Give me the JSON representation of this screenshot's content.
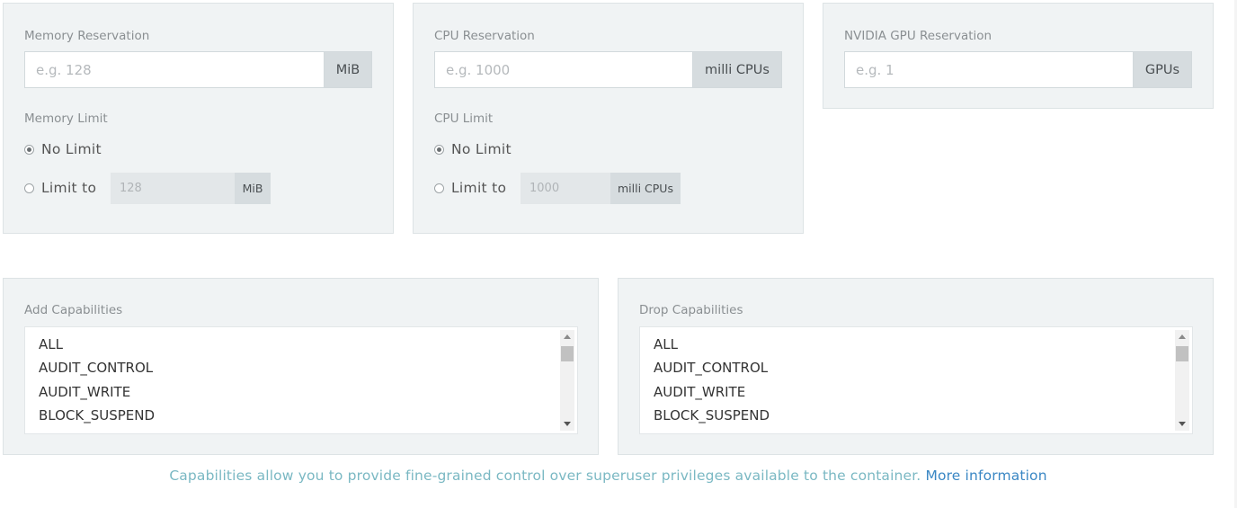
{
  "memory": {
    "reservation_label": "Memory Reservation",
    "reservation_placeholder": "e.g. 128",
    "reservation_unit": "MiB",
    "limit_label": "Memory Limit",
    "no_limit_label": "No Limit",
    "limit_to_label": "Limit to",
    "limit_to_placeholder": "128",
    "limit_to_unit": "MiB",
    "selected": "No Limit"
  },
  "cpu": {
    "reservation_label": "CPU Reservation",
    "reservation_placeholder": "e.g. 1000",
    "reservation_unit": "milli CPUs",
    "limit_label": "CPU Limit",
    "no_limit_label": "No Limit",
    "limit_to_label": "Limit to",
    "limit_to_placeholder": "1000",
    "limit_to_unit": "milli CPUs",
    "selected": "No Limit"
  },
  "gpu": {
    "reservation_label": "NVIDIA GPU Reservation",
    "reservation_placeholder": "e.g. 1",
    "reservation_unit": "GPUs"
  },
  "add_capabilities": {
    "label": "Add Capabilities",
    "items": [
      "ALL",
      "AUDIT_CONTROL",
      "AUDIT_WRITE",
      "BLOCK_SUSPEND"
    ]
  },
  "drop_capabilities": {
    "label": "Drop Capabilities",
    "items": [
      "ALL",
      "AUDIT_CONTROL",
      "AUDIT_WRITE",
      "BLOCK_SUSPEND"
    ]
  },
  "help": {
    "text": "Capabilities allow you to provide fine-grained control over superuser privileges available to the container.",
    "link_text": "More information"
  },
  "colors": {
    "panel_bg": "#f0f3f4",
    "addon_bg": "#d6dcdf",
    "help_text": "#7ab8c3",
    "link": "#3a87c4"
  }
}
